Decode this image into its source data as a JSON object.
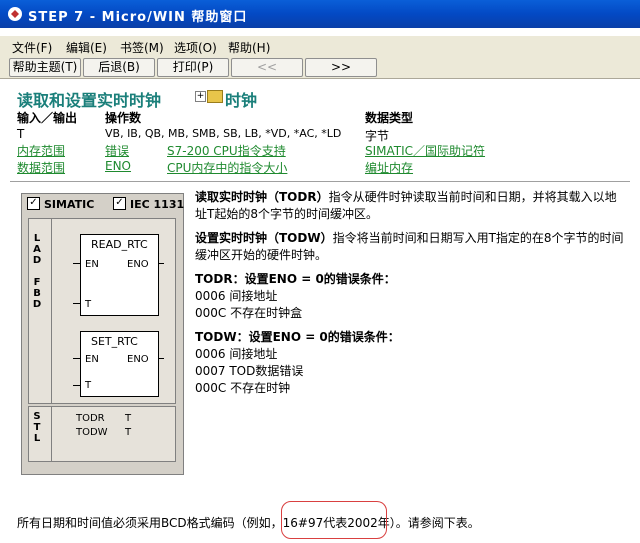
{
  "window": {
    "title": "STEP 7 - Micro/WIN 帮助窗口",
    "app_icon": "step7-icon"
  },
  "menu": {
    "items": [
      "文件(F)",
      "编辑(E)",
      "书签(M)",
      "选项(O)",
      "帮助(H)"
    ]
  },
  "toolbar": {
    "buttons": [
      {
        "label": "帮助主题(T)",
        "enabled": true
      },
      {
        "label": "后退(B)",
        "enabled": true
      },
      {
        "label": "打印(P)",
        "enabled": true
      },
      {
        "label": "<<",
        "enabled": false
      },
      {
        "label": ">>",
        "enabled": true
      }
    ]
  },
  "page": {
    "title": "读取和设置实时时钟",
    "related": "时钟",
    "headers": {
      "in_out": "输入／输出",
      "operands": "操作数",
      "data_type": "数据类型"
    },
    "row_t": {
      "name": "T",
      "operands": "VB, IB, QB, MB, SMB, SB, LB, *VD, *AC, *LD",
      "type": "字节"
    },
    "links1": [
      "内存范围",
      "错误",
      "S7-200 CPU指令支持",
      "SIMATIC／国际助记符"
    ],
    "links2": [
      "数据范围",
      "ENO",
      "CPU内存中的指令大小",
      "编址内存"
    ],
    "lad_box": {
      "simatic": "SIMATIC",
      "iec": "IEC 1131",
      "lad_label": [
        "L",
        "A",
        "D",
        "",
        "F",
        "B",
        "D"
      ],
      "stl_label": [
        "S",
        "T",
        "L"
      ],
      "block1": {
        "name": "READ_RTC",
        "en": "EN",
        "eno": "ENO",
        "t": "T"
      },
      "block2": {
        "name": "SET_RTC",
        "en": "EN",
        "eno": "ENO",
        "t": "T"
      },
      "stl": [
        {
          "op": "TODR",
          "arg": "T"
        },
        {
          "op": "TODW",
          "arg": "T"
        }
      ]
    },
    "desc": {
      "p1_bold": "读取实时时钟（TODR）",
      "p1_line1": "指令从硬件时钟读取当前时间和日期，并将其载入以地",
      "p1_line2": "址T起始的8个字节的时间缓冲区。",
      "p2_bold": "设置实时时钟（TODW）",
      "p2_line1": "指令将当前时间和日期写入用T指定的在8个字节的时间",
      "p2_line2": "缓冲区开始的硬件时钟。",
      "todr_title": "TODR：设置ENO = 0的错误条件：",
      "todr_errors": [
        "0006  间接地址",
        "000C  不存在时钟盒"
      ],
      "todw_title": "TODW：设置ENO = 0的错误条件：",
      "todw_errors": [
        "0006  间接地址",
        "0007  TOD数据错误",
        "000C  不存在时钟"
      ]
    },
    "footer": {
      "pre": "所有日期和时间值必须采用BCD格式编码（例如，",
      "highlight": "16#97代表2002年",
      "post": "）。请参阅下表。"
    },
    "colors": {
      "heading": "#1a7f7a",
      "link": "#1f8a2f",
      "titlebar": "#0a5fd8",
      "annotation": "#d94040"
    }
  }
}
